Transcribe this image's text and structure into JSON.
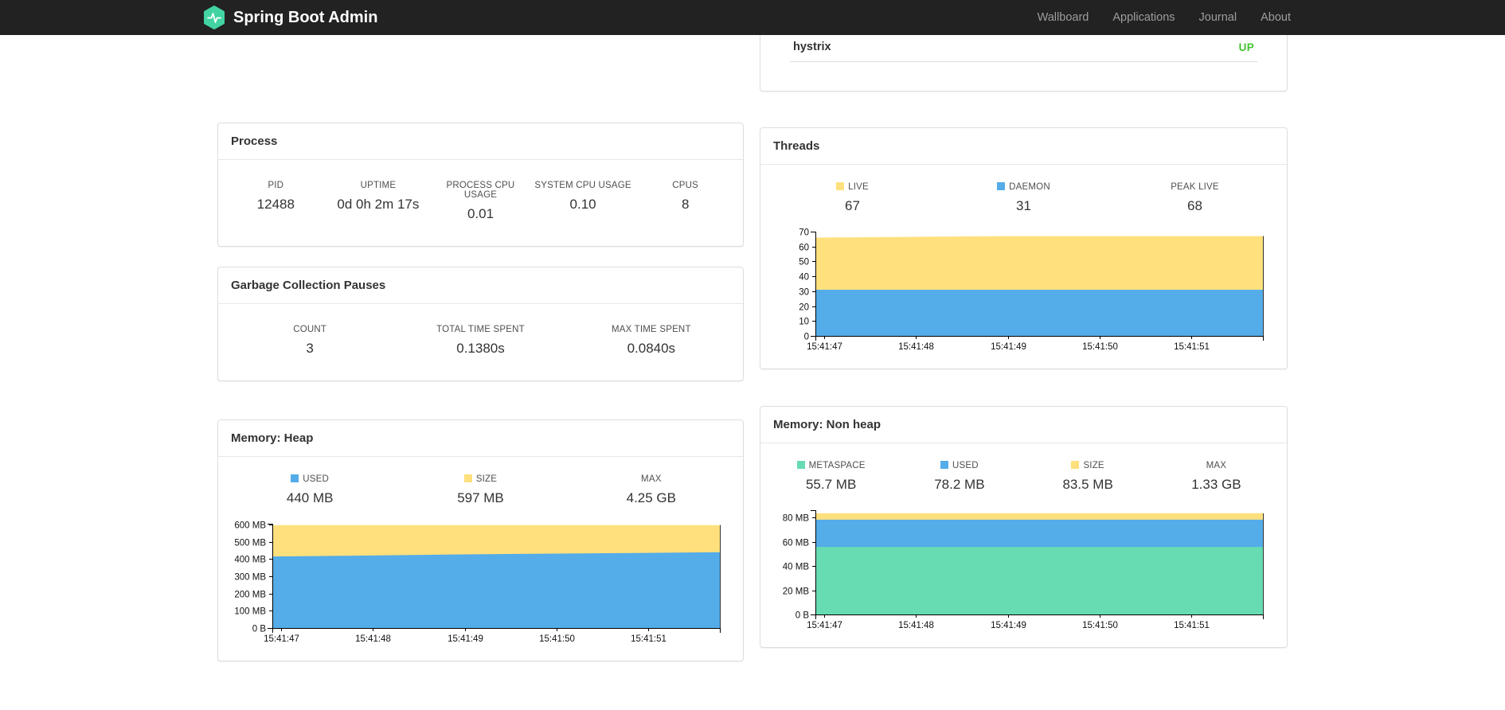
{
  "navbar": {
    "brand": "Spring Boot Admin",
    "items": [
      {
        "label": "Wallboard"
      },
      {
        "label": "Applications"
      },
      {
        "label": "Journal"
      },
      {
        "label": "About"
      }
    ]
  },
  "application": {
    "name": "hystrix",
    "status": "UP"
  },
  "process": {
    "title": "Process",
    "stats": [
      {
        "label": "PID",
        "value": "12488"
      },
      {
        "label": "UPTIME",
        "value": "0d 0h 2m 17s"
      },
      {
        "label": "PROCESS CPU USAGE",
        "value": "0.01"
      },
      {
        "label": "SYSTEM CPU USAGE",
        "value": "0.10"
      },
      {
        "label": "CPUS",
        "value": "8"
      }
    ]
  },
  "gc": {
    "title": "Garbage Collection Pauses",
    "stats": [
      {
        "label": "COUNT",
        "value": "3"
      },
      {
        "label": "TOTAL TIME SPENT",
        "value": "0.1380s"
      },
      {
        "label": "MAX TIME SPENT",
        "value": "0.0840s"
      }
    ]
  },
  "threads": {
    "title": "Threads",
    "legend": [
      {
        "label": "LIVE",
        "value": "67",
        "color": "yellow"
      },
      {
        "label": "DAEMON",
        "value": "31",
        "color": "blue"
      },
      {
        "label": "PEAK LIVE",
        "value": "68",
        "color": "none"
      }
    ]
  },
  "heap": {
    "title": "Memory: Heap",
    "legend": [
      {
        "label": "USED",
        "value": "440 MB",
        "color": "blue"
      },
      {
        "label": "SIZE",
        "value": "597 MB",
        "color": "yellow"
      },
      {
        "label": "MAX",
        "value": "4.25 GB",
        "color": "none"
      }
    ]
  },
  "nonheap": {
    "title": "Memory: Non heap",
    "legend": [
      {
        "label": "METASPACE",
        "value": "55.7 MB",
        "color": "green"
      },
      {
        "label": "USED",
        "value": "78.2 MB",
        "color": "blue"
      },
      {
        "label": "SIZE",
        "value": "83.5 MB",
        "color": "yellow"
      },
      {
        "label": "MAX",
        "value": "1.33 GB",
        "color": "none"
      }
    ]
  },
  "colors": {
    "brand_green": "#42D3A2",
    "status_up_green": "#43C330",
    "series_yellow": "#FFE07D",
    "series_blue": "#54ACE8",
    "series_green": "#67DBB2",
    "navbar_bg": "#222222"
  },
  "chart_data": [
    {
      "type": "area",
      "title": "Threads",
      "x": [
        "15:41:47",
        "15:41:48",
        "15:41:49",
        "15:41:50",
        "15:41:51"
      ],
      "label_fractions": [
        0.02,
        0.225,
        0.43,
        0.635,
        0.84
      ],
      "x_fractions": [
        0,
        0.225,
        0.43,
        0.635,
        0.84,
        1
      ],
      "ylim": [
        0,
        70
      ],
      "yticks": [
        {
          "v": 0,
          "label": "0"
        },
        {
          "v": 10,
          "label": "10"
        },
        {
          "v": 20,
          "label": "20"
        },
        {
          "v": 30,
          "label": "30"
        },
        {
          "v": 40,
          "label": "40"
        },
        {
          "v": 50,
          "label": "50"
        },
        {
          "v": 60,
          "label": "60"
        },
        {
          "v": 70,
          "label": "70"
        }
      ],
      "series": [
        {
          "name": "LIVE",
          "color": "#FFE07D",
          "values": [
            66,
            66.5,
            67,
            67,
            67,
            67
          ]
        },
        {
          "name": "DAEMON",
          "color": "#54ACE8",
          "values": [
            31,
            31,
            31,
            31,
            31,
            31
          ]
        }
      ]
    },
    {
      "type": "area",
      "title": "Memory: Heap",
      "x": [
        "15:41:47",
        "15:41:48",
        "15:41:49",
        "15:41:50",
        "15:41:51"
      ],
      "label_fractions": [
        0.02,
        0.225,
        0.43,
        0.635,
        0.84
      ],
      "x_fractions": [
        0,
        0.225,
        0.43,
        0.635,
        0.84,
        1
      ],
      "ylim": [
        0,
        605
      ],
      "yticks": [
        {
          "v": 0,
          "label": "0 B"
        },
        {
          "v": 100,
          "label": "100 MB"
        },
        {
          "v": 200,
          "label": "200 MB"
        },
        {
          "v": 300,
          "label": "300 MB"
        },
        {
          "v": 400,
          "label": "400 MB"
        },
        {
          "v": 500,
          "label": "500 MB"
        },
        {
          "v": 600,
          "label": "600 MB"
        }
      ],
      "series": [
        {
          "name": "SIZE",
          "color": "#FFE07D",
          "values": [
            597,
            597,
            597,
            597,
            597,
            597
          ]
        },
        {
          "name": "USED",
          "color": "#54ACE8",
          "values": [
            415,
            421,
            427,
            432,
            436,
            440
          ]
        }
      ]
    },
    {
      "type": "area",
      "title": "Memory: Non heap",
      "x": [
        "15:41:47",
        "15:41:48",
        "15:41:49",
        "15:41:50",
        "15:41:51"
      ],
      "label_fractions": [
        0.02,
        0.225,
        0.43,
        0.635,
        0.84
      ],
      "x_fractions": [
        0,
        0.225,
        0.43,
        0.635,
        0.84,
        1
      ],
      "ylim": [
        0,
        86
      ],
      "yticks": [
        {
          "v": 0,
          "label": "0 B"
        },
        {
          "v": 20,
          "label": "20 MB"
        },
        {
          "v": 40,
          "label": "40 MB"
        },
        {
          "v": 60,
          "label": "60 MB"
        },
        {
          "v": 80,
          "label": "80 MB"
        }
      ],
      "series": [
        {
          "name": "SIZE",
          "color": "#FFE07D",
          "values": [
            83.5,
            83.5,
            83.5,
            83.5,
            83.5,
            83.5
          ]
        },
        {
          "name": "USED",
          "color": "#54ACE8",
          "values": [
            78.2,
            78.2,
            78.2,
            78.2,
            78.2,
            78.2
          ]
        },
        {
          "name": "METASPACE",
          "color": "#67DBB2",
          "values": [
            55.7,
            55.7,
            55.7,
            55.7,
            55.7,
            55.7
          ]
        }
      ]
    }
  ]
}
